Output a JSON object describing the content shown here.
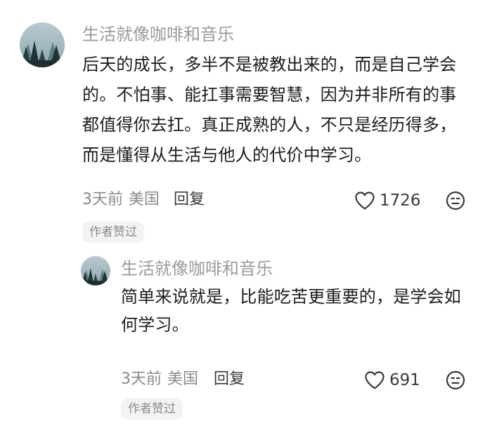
{
  "comment": {
    "username": "生活就像咖啡和音乐",
    "avatar_icon": "forest-avatar-icon",
    "text": "后天的成长，多半不是被教出来的，而是自己学会的。不怕事、能扛事需要智慧，因为并非所有的事都值得你去扛。真正成熟的人，不只是经历得多，而是懂得从生活与他人的代价中学习。",
    "time": "3天前",
    "location": "美国",
    "reply_label": "回复",
    "like_count": "1726",
    "badge": "作者赞过"
  },
  "reply": {
    "username": "生活就像咖啡和音乐",
    "avatar_icon": "forest-avatar-icon",
    "text": "简单来说就是，比能吃苦更重要的，是学会如何学习。",
    "time": "3天前",
    "location": "美国",
    "reply_label": "回复",
    "like_count": "691",
    "badge": "作者赞过"
  },
  "colors": {
    "username": "#9a9a9a",
    "text": "#1c1c1c",
    "meta": "#8a8a8a",
    "badge_bg": "#f3f3f3"
  }
}
